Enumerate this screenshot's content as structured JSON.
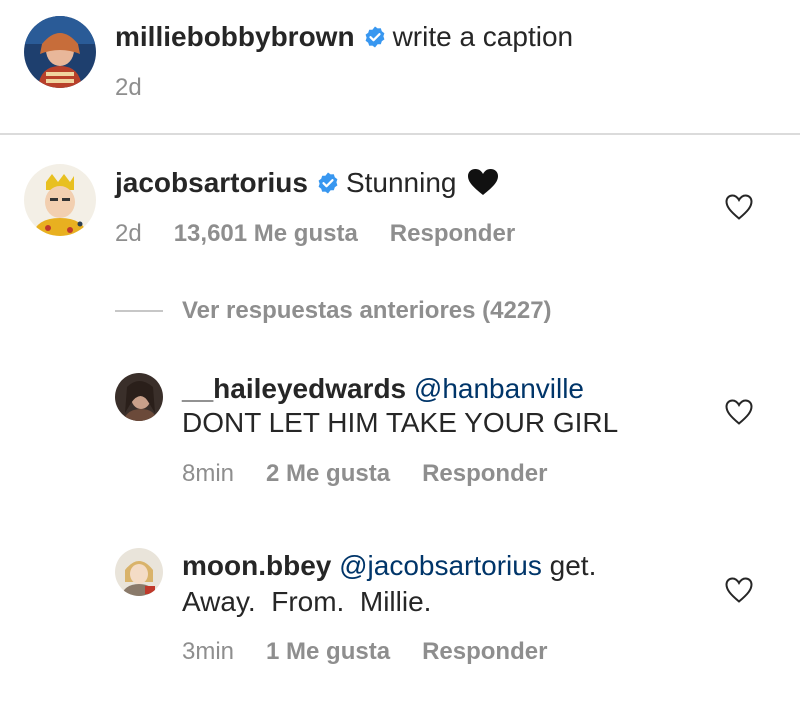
{
  "post": {
    "username": "milliebobbybrown",
    "caption": "write a caption",
    "time": "2d"
  },
  "comment": {
    "username": "jacobsartorius",
    "text": "Stunning",
    "emoji": "🖤",
    "time": "2d",
    "likes": "13,601 Me gusta",
    "reply_label": "Responder",
    "view_replies": "Ver respuestas anteriores (4227)"
  },
  "replies": [
    {
      "username": "__haileyedwards",
      "mention": "@hanbanville",
      "text": "DONT LET HIM TAKE YOUR GIRL",
      "time": "8min",
      "likes": "2 Me gusta",
      "reply_label": "Responder"
    },
    {
      "username": "moon.bbey",
      "mention": "@jacobsartorius",
      "text_inline": "get.",
      "text_line2": "Away.  From.  Millie.",
      "time": "3min",
      "likes": "1 Me gusta",
      "reply_label": "Responder"
    }
  ],
  "colors": {
    "verified": "#3897f0",
    "mention": "#003569",
    "meta": "#8e8e8e",
    "divider": "#dbdbdb"
  },
  "icons": {
    "verified": "verified-badge-icon",
    "like": "heart-outline-icon",
    "separator": "dash-line"
  }
}
